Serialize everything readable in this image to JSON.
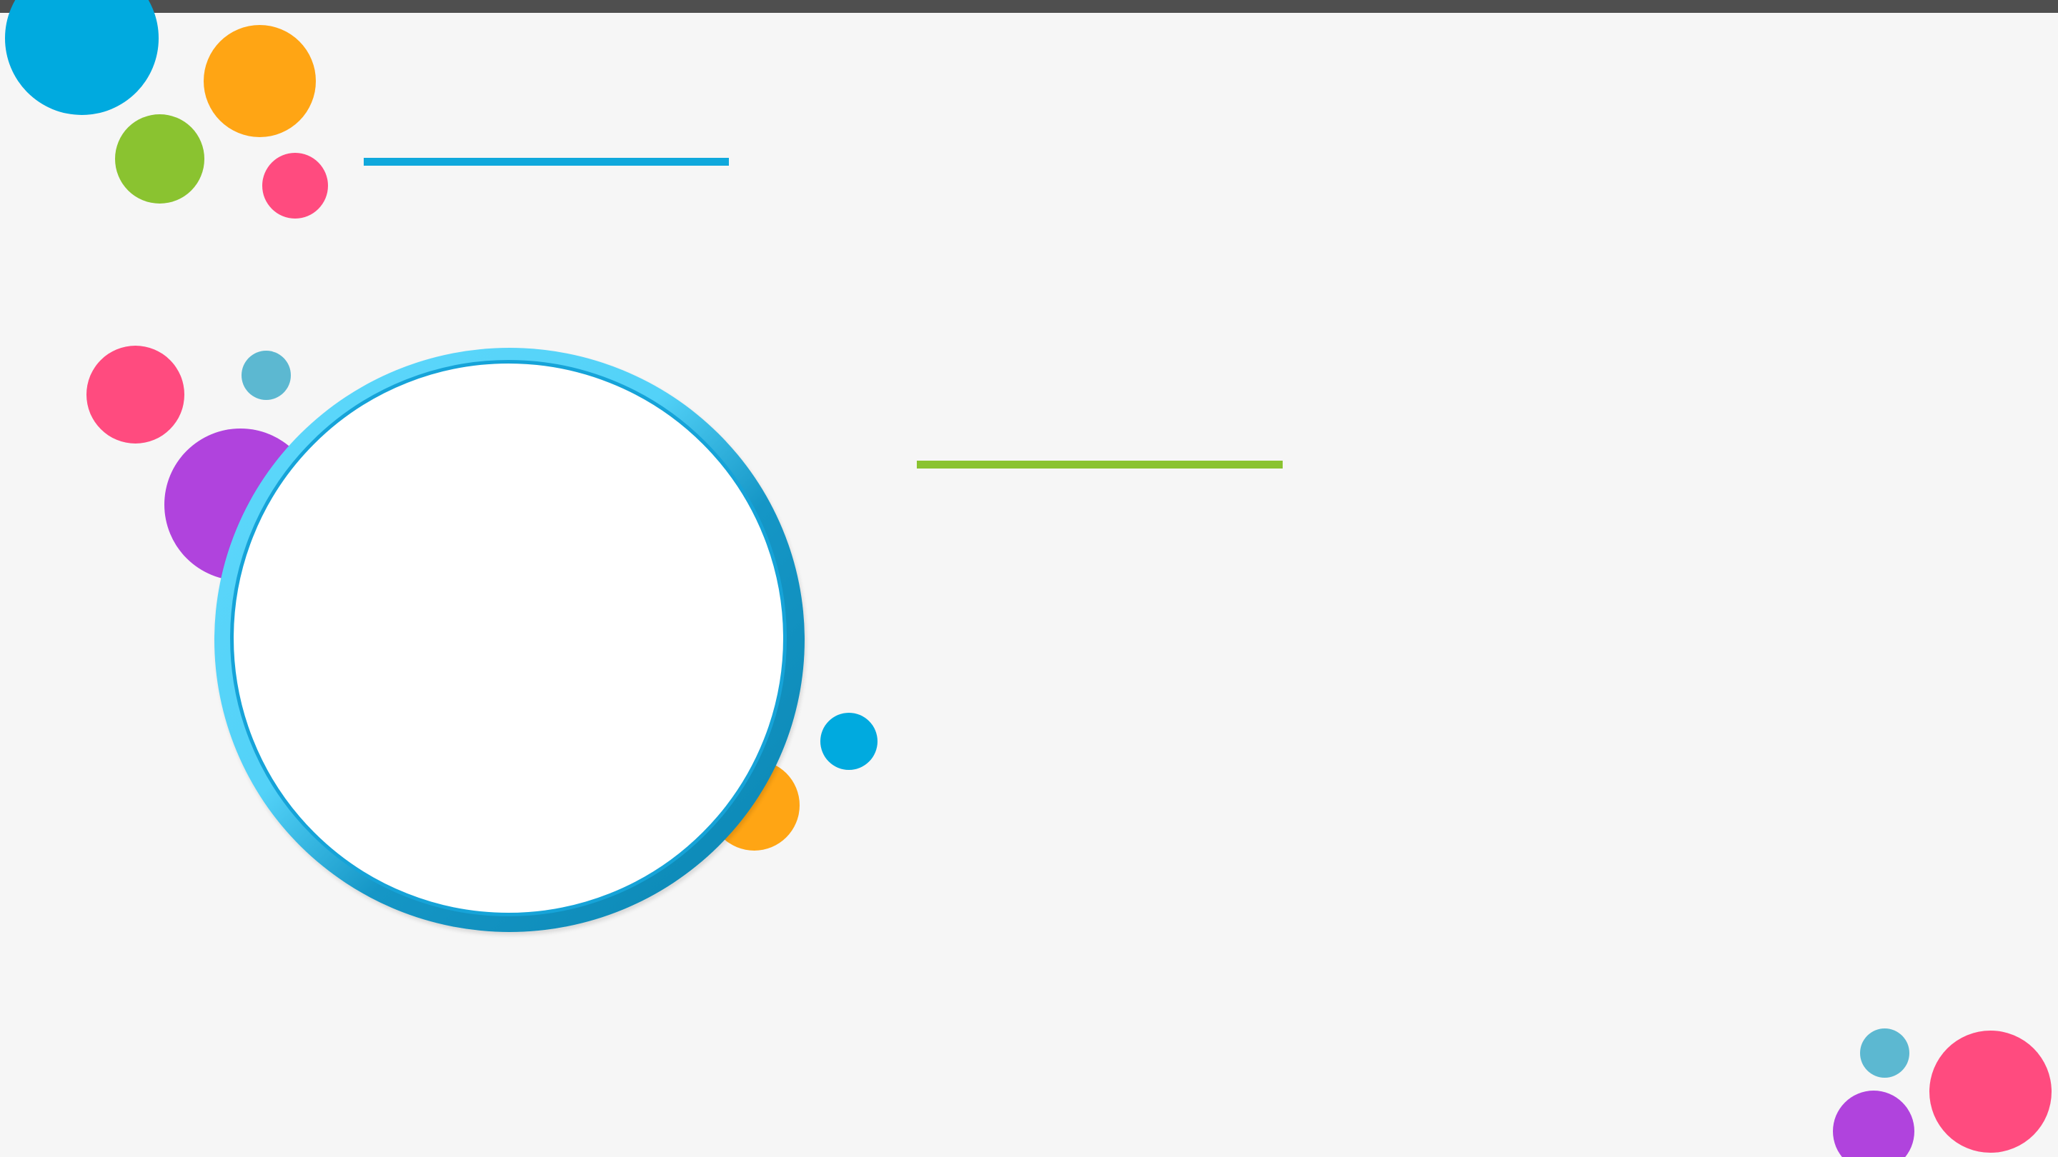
{
  "slide": {
    "background": "#f6f6f6",
    "topbar_color": "#4f4f4f"
  },
  "palette": {
    "blue": "#00aadf",
    "orange": "#ffa514",
    "green": "#8ac330",
    "pink": "#ff4b7f",
    "purple": "#b043dd",
    "teal": "#5cb8d1"
  },
  "dots": [
    {
      "name": "decor-dot-blue-large",
      "color": "#00aadf"
    },
    {
      "name": "decor-dot-orange",
      "color": "#ffa514"
    },
    {
      "name": "decor-dot-green",
      "color": "#8ac330"
    },
    {
      "name": "decor-dot-pink-small",
      "color": "#ff4b7f"
    },
    {
      "name": "decor-dot-pink",
      "color": "#ff4b7f"
    },
    {
      "name": "decor-dot-teal",
      "color": "#5cb8d1"
    },
    {
      "name": "decor-dot-purple",
      "color": "#b043dd"
    },
    {
      "name": "decor-dot-orange-lower",
      "color": "#ffa514"
    },
    {
      "name": "decor-dot-blue-small",
      "color": "#00aadf"
    },
    {
      "name": "decor-dot-teal-corner",
      "color": "#5cb8d1"
    },
    {
      "name": "decor-dot-pink-corner",
      "color": "#ff4b7f"
    },
    {
      "name": "decor-dot-purple-corner",
      "color": "#b043dd"
    }
  ],
  "rules": {
    "top": {
      "color": "#0fa8dc"
    },
    "middle": {
      "color": "#8ac330"
    }
  },
  "frame": {
    "ring_color": "#5ad6fa",
    "ring_shadow_color": "#0a86b2",
    "fill_color": "#ffffff"
  }
}
